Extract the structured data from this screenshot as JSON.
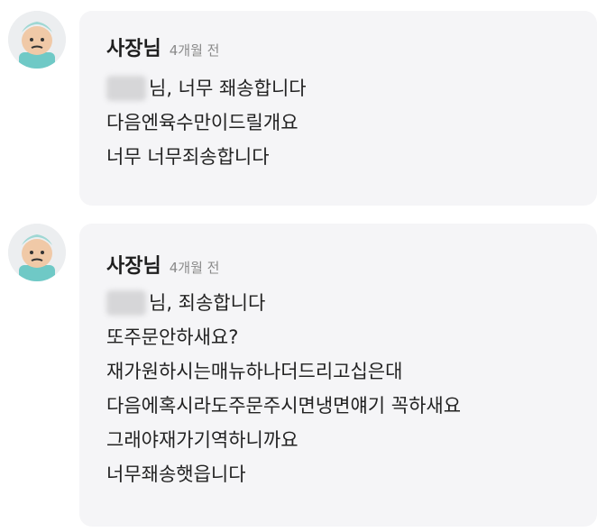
{
  "replies": [
    {
      "author": "사장님",
      "time": "4개월 전",
      "lines": [
        {
          "text": "님, 너무 좨송합니다",
          "blurred_prefix": true
        },
        {
          "text": "다음엔육수만이드릴개요",
          "blurred_prefix": false
        },
        {
          "text": "너무 너무죄송합니다",
          "blurred_prefix": false
        }
      ]
    },
    {
      "author": "사장님",
      "time": "4개월 전",
      "lines": [
        {
          "text": "님, 죄송합니다",
          "blurred_prefix": true
        },
        {
          "text": "또주문안하새요?",
          "blurred_prefix": false
        },
        {
          "text": "재가원하시는매뉴하나더드리고십은대",
          "blurred_prefix": false
        },
        {
          "text": "다음에혹시라도주문주시면냉면얘기 꼭하새요",
          "blurred_prefix": false
        },
        {
          "text": "그래야재가기역하니까요",
          "blurred_prefix": false
        },
        {
          "text": "너무좨송햇읍니다",
          "blurred_prefix": false
        }
      ]
    }
  ]
}
